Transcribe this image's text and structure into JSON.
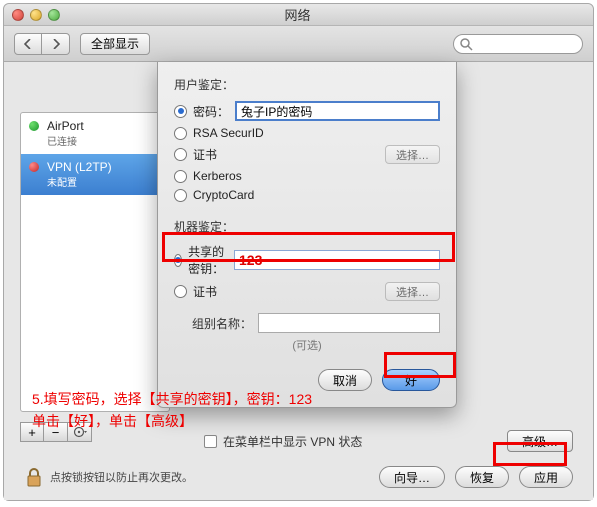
{
  "window": {
    "title": "网络"
  },
  "toolbar": {
    "showall": "全部显示"
  },
  "sidebar": {
    "items": [
      {
        "name": "AirPort",
        "sub": "已连接"
      },
      {
        "name": "VPN (L2TP)",
        "sub": "未配置"
      }
    ]
  },
  "sheet": {
    "userauth_label": "用户鉴定：",
    "radios": {
      "password": "密码：",
      "rsa": "RSA SecurID",
      "cert": "证书",
      "kerberos": "Kerberos",
      "crypto": "CryptoCard"
    },
    "password_value": "兔子IP的密码",
    "choose": "选择…",
    "machineauth_label": "机器鉴定：",
    "shared_key_label": "共享的密钥：",
    "shared_key_value": "123",
    "cert2": "证书",
    "choose2": "选择…",
    "groupname_label": "组别名称：",
    "groupname_value": "",
    "optional": "(可选)",
    "cancel": "取消",
    "ok": "好"
  },
  "advrow": {
    "checkbox_label": "在菜单栏中显示 VPN 状态",
    "advanced": "高级…"
  },
  "lock_text": "点按锁按钮以防止再次更改。",
  "bottom": {
    "assist": "向导…",
    "revert": "恢复",
    "apply": "应用"
  },
  "annotation": {
    "line1": "5.填写密码，选择【共享的密钥】，密钥：123",
    "line2": "单击【好】，单击【高级】"
  }
}
